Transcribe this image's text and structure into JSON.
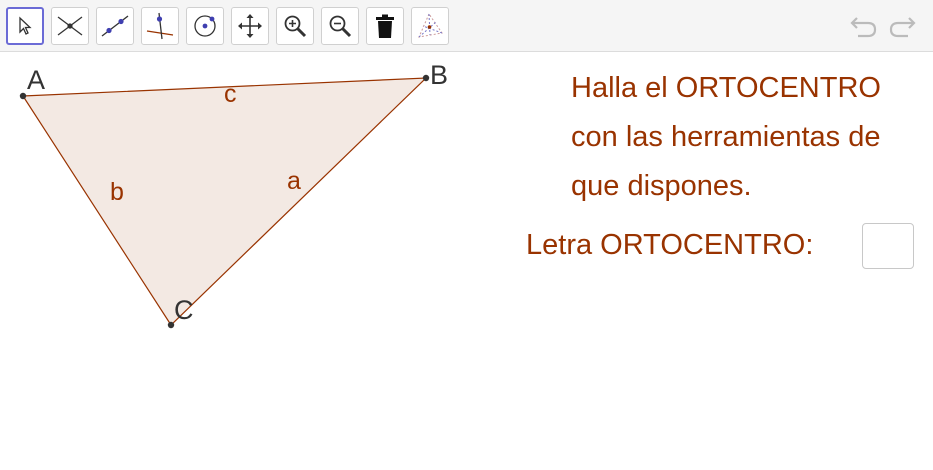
{
  "toolbar": {
    "tools": [
      {
        "name": "move",
        "icon": "pointer-arrow-icon",
        "selected": true
      },
      {
        "name": "intersect",
        "icon": "intersect-lines-icon",
        "selected": false
      },
      {
        "name": "line",
        "icon": "line-through-points-icon",
        "selected": false
      },
      {
        "name": "perpendicular-line",
        "icon": "perpendicular-line-icon",
        "selected": false
      },
      {
        "name": "circle",
        "icon": "circle-center-point-icon",
        "selected": false
      },
      {
        "name": "move-graphics-view",
        "icon": "move-cross-arrows-icon",
        "selected": false
      },
      {
        "name": "zoom-in",
        "icon": "zoom-in-icon",
        "selected": false
      },
      {
        "name": "zoom-out",
        "icon": "zoom-out-icon",
        "selected": false
      },
      {
        "name": "delete",
        "icon": "trash-icon",
        "selected": false
      },
      {
        "name": "orthocenter",
        "icon": "triangle-altitudes-icon",
        "selected": false
      }
    ],
    "undo_icon": "undo-icon",
    "redo_icon": "redo-icon"
  },
  "construction": {
    "points": [
      {
        "label": "A"
      },
      {
        "label": "B"
      },
      {
        "label": "C"
      }
    ],
    "sides": [
      {
        "label": "c",
        "between": [
          "A",
          "B"
        ]
      },
      {
        "label": "b",
        "between": [
          "A",
          "C"
        ]
      },
      {
        "label": "a",
        "between": [
          "B",
          "C"
        ]
      }
    ],
    "fill_color": "#f3e9e3",
    "stroke_color": "#993300",
    "point_color": "#333333"
  },
  "instructions": {
    "lines": [
      "Halla el ORTOCENTRO",
      "con las herramientas de",
      "que dispones."
    ]
  },
  "answer": {
    "label": "Letra ORTOCENTRO:",
    "value": ""
  },
  "colors": {
    "text_accent": "#993300",
    "selected_tool_border": "#6b6bd6"
  }
}
